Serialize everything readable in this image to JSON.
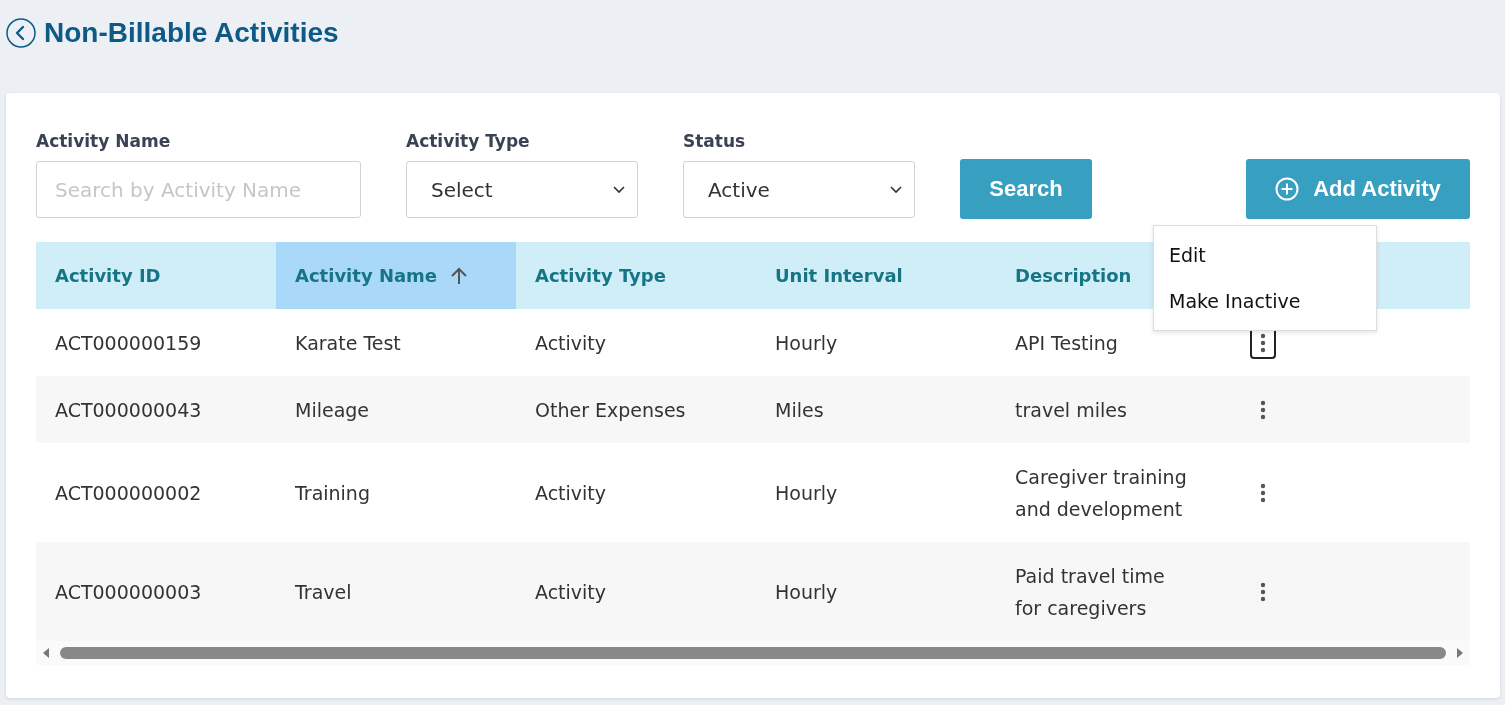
{
  "page": {
    "title": "Non-Billable Activities"
  },
  "filters": [
    {
      "kind": "input",
      "label": "Activity Name",
      "placeholder": "Search by Activity Name"
    },
    {
      "kind": "select",
      "label": "Activity Type",
      "value": "Select"
    },
    {
      "kind": "select",
      "label": "Status",
      "value": "Active"
    }
  ],
  "search_button": "Search",
  "add_button": "Add Activity",
  "table": {
    "columns": [
      {
        "label": "Activity ID",
        "sorted": false
      },
      {
        "label": "Activity Name",
        "sorted": true
      },
      {
        "label": "Activity Type",
        "sorted": false
      },
      {
        "label": "Unit Interval",
        "sorted": false
      },
      {
        "label": "Description",
        "sorted": false
      }
    ],
    "rows": [
      {
        "cells": [
          "ACT000000159",
          "Karate Test",
          "Activity",
          "Hourly",
          "API Testing"
        ],
        "menu_open": true
      },
      {
        "cells": [
          "ACT000000043",
          "Mileage",
          "Other Expenses",
          "Miles",
          "travel miles"
        ],
        "menu_open": false
      },
      {
        "cells": [
          "ACT000000002",
          "Training",
          "Activity",
          "Hourly",
          "Caregiver training and development"
        ],
        "menu_open": false
      },
      {
        "cells": [
          "ACT000000003",
          "Travel",
          "Activity",
          "Hourly",
          "Paid travel time for caregivers"
        ],
        "menu_open": false
      }
    ]
  },
  "row_menu": [
    "Edit",
    "Make Inactive"
  ]
}
